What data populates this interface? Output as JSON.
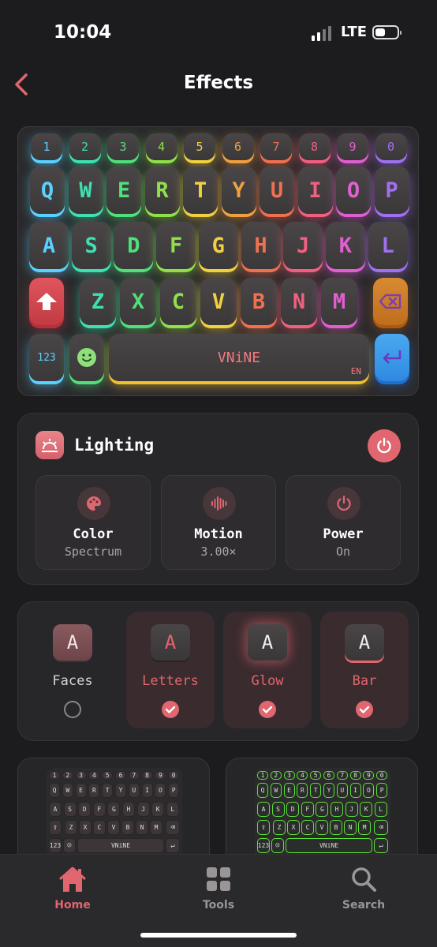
{
  "status_bar": {
    "time": "10:04",
    "network": "LTE"
  },
  "nav": {
    "title": "Effects"
  },
  "keyboard": {
    "number_row": [
      "1",
      "2",
      "3",
      "4",
      "5",
      "6",
      "7",
      "8",
      "9",
      "0"
    ],
    "row1": [
      "Q",
      "W",
      "E",
      "R",
      "T",
      "Y",
      "U",
      "I",
      "O",
      "P"
    ],
    "row2": [
      "A",
      "S",
      "D",
      "F",
      "G",
      "H",
      "J",
      "K",
      "L"
    ],
    "row3": [
      "Z",
      "X",
      "C",
      "V",
      "B",
      "N",
      "M"
    ],
    "num_key": "123",
    "space_label": "VNiNE",
    "lang": "EN",
    "colors": [
      "#5ad1ff",
      "#3fe0b0",
      "#4fe07a",
      "#8fe04a",
      "#f0d040",
      "#f0a040",
      "#f07050",
      "#f06080",
      "#e060d0",
      "#a070f0"
    ]
  },
  "lighting": {
    "title": "Lighting",
    "tiles": [
      {
        "title": "Color",
        "value": "Spectrum",
        "icon": "palette-icon"
      },
      {
        "title": "Motion",
        "value": "3.00×",
        "icon": "waveform-icon"
      },
      {
        "title": "Power",
        "value": "On",
        "icon": "power-icon"
      }
    ]
  },
  "style_options": [
    {
      "letter": "A",
      "label": "Faces",
      "selected": false
    },
    {
      "letter": "A",
      "label": "Letters",
      "selected": true
    },
    {
      "letter": "A",
      "label": "Glow",
      "selected": true
    },
    {
      "letter": "A",
      "label": "Bar",
      "selected": true
    }
  ],
  "thumbnails": [
    {
      "space_label": "VNiNE",
      "num_key": "123"
    },
    {
      "space_label": "VNiNE",
      "num_key": "123"
    }
  ],
  "tabbar": {
    "home": "Home",
    "tools": "Tools",
    "search": "Search"
  },
  "colors": {
    "accent": "#e0666f",
    "background": "#1c1b1d",
    "card": "#272628"
  }
}
